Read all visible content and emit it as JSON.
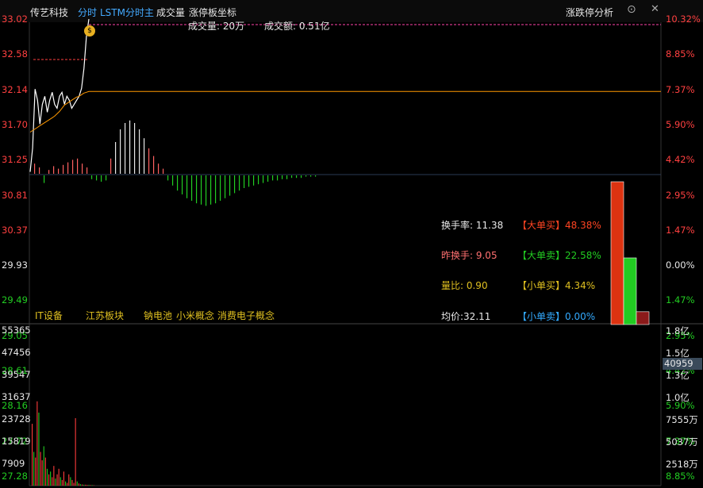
{
  "header": {
    "stock_name": "传艺科技",
    "tabs": [
      "分时",
      "LSTM分时主",
      "成交量",
      "涨停板坐标"
    ],
    "right_title": "涨跌停分析"
  },
  "colors": {
    "up": "#ff3b3b",
    "down": "#22cc22",
    "flat": "#e0e0e0",
    "price_line": "#ffffff",
    "avg_line": "#ff9900",
    "accent_blue": "#44aaff",
    "yellow": "#e0c020"
  },
  "price_axis": {
    "left": [
      "33.02",
      "32.58",
      "32.14",
      "31.70",
      "31.25",
      "30.81",
      "30.37",
      "29.93",
      "29.49",
      "29.05",
      "28.61",
      "28.16",
      "27.72",
      "27.28"
    ],
    "right": [
      "10.32%",
      "8.85%",
      "7.37%",
      "5.90%",
      "4.42%",
      "2.95%",
      "1.47%",
      "0.00%",
      "1.47%",
      "2.95%",
      "4.42%",
      "5.90%",
      "7.37%",
      "8.85%"
    ]
  },
  "overlay": {
    "volume_label": "成交量: 20万",
    "amount_label": "成交额: 0.51亿"
  },
  "stats": {
    "turnover": "换手率: 11.38",
    "prev_turnover": "昨换手: 9.05",
    "volume_ratio": "量比: 0.90",
    "avg_price": "均价:32.11",
    "big_buy": "【大单买】48.38%",
    "big_sell": "【大单卖】22.58%",
    "small_buy": "【小单买】4.34%",
    "small_sell": "【小单卖】0.00%"
  },
  "concepts": [
    "IT设备",
    "江苏板块",
    "钠电池",
    "小米概念",
    "消费电子概念"
  ],
  "volume_axis": {
    "left": [
      "55365",
      "47456",
      "39547",
      "31637",
      "23728",
      "15819",
      "7909"
    ],
    "right": [
      "1.8亿",
      "1.5亿",
      "1.3亿",
      "1.0亿",
      "7555万",
      "5037万",
      "2518万"
    ],
    "current": "40959"
  },
  "order_flow_bars": [
    {
      "name": "大单买",
      "value": 48.38,
      "color": "#dd3311"
    },
    {
      "name": "大单卖",
      "value": 22.58,
      "color": "#22cc22"
    },
    {
      "name": "小单卖",
      "value": 4.34,
      "color": "#8b1a1a"
    }
  ],
  "price_series": [
    31.1,
    31.4,
    32.14,
    32.0,
    31.7,
    31.95,
    32.05,
    31.85,
    32.0,
    32.1,
    31.95,
    31.9,
    32.05,
    32.1,
    31.95,
    32.05,
    32.0,
    31.9,
    31.95,
    32.0,
    32.05,
    32.15,
    32.4,
    32.8,
    33.02
  ],
  "avg_series": [
    31.6,
    31.62,
    31.64,
    31.66,
    31.68,
    31.7,
    31.72,
    31.74,
    31.76,
    31.78,
    31.8,
    31.83,
    31.86,
    31.9,
    31.94,
    31.96,
    31.98,
    32.0,
    32.02,
    32.04,
    32.05,
    32.07,
    32.09,
    32.1,
    32.11
  ],
  "avg_tail": 32.11,
  "macd_bars": [
    8,
    5,
    -6,
    3,
    6,
    4,
    7,
    9,
    11,
    12,
    8,
    5,
    -3,
    -4,
    -5,
    -4,
    12,
    25,
    35,
    40,
    42,
    40,
    35,
    28,
    20,
    14,
    8,
    4,
    -4,
    -8,
    -12,
    -15,
    -18,
    -20,
    -22,
    -23,
    -24,
    -23,
    -22,
    -20,
    -18,
    -16,
    -14,
    -12,
    -10,
    -9,
    -8,
    -7,
    -6,
    -5,
    -4,
    -4,
    -3,
    -3,
    -2,
    -2,
    -2,
    -1,
    -1,
    -1
  ],
  "volume_bars": [
    22000,
    12000,
    10000,
    30000,
    26000,
    12000,
    9000,
    14000,
    10000,
    6000,
    4000,
    5000,
    3000,
    7000,
    2500,
    4000,
    6000,
    3000,
    2000,
    5000,
    1500,
    1000,
    4000,
    3000,
    2000,
    1000,
    24000,
    1500,
    800,
    500,
    400,
    300,
    300,
    250,
    250,
    200,
    200,
    150
  ],
  "volume_colors": [
    "up",
    "down",
    "up",
    "up",
    "down",
    "up",
    "up",
    "down",
    "up",
    "down",
    "up",
    "down",
    "up",
    "up",
    "down",
    "up",
    "up",
    "down",
    "up",
    "up",
    "down",
    "up",
    "up",
    "down",
    "up",
    "up",
    "up",
    "down",
    "up",
    "down",
    "up",
    "down",
    "up",
    "up",
    "down",
    "up",
    "down",
    "up"
  ]
}
